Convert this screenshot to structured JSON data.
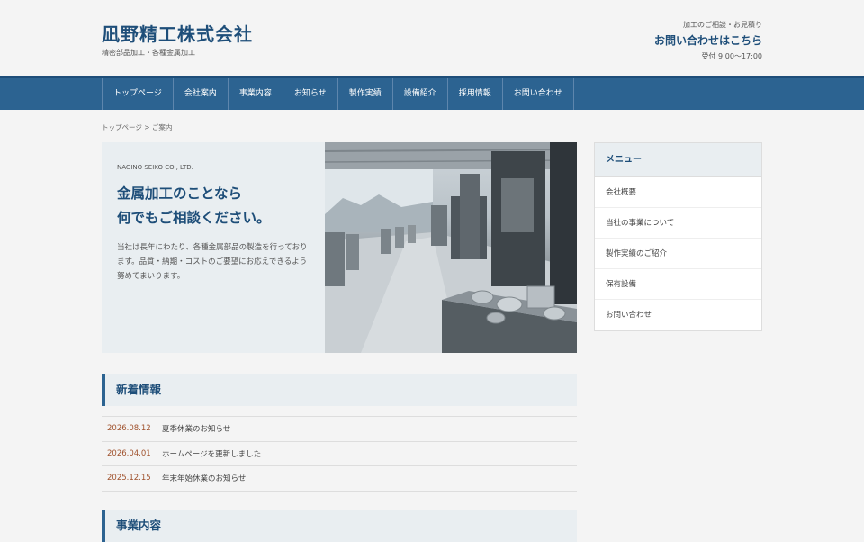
{
  "header": {
    "title": "凪野精工株式会社",
    "subtitle": "精密部品加工・各種金属加工",
    "contact_small": "加工のご相談・お見積り",
    "contact_main": "お問い合わせはこちら",
    "contact_hours": "受付 9:00〜17:00"
  },
  "nav": {
    "items": [
      "トップページ",
      "会社案内",
      "事業内容",
      "お知らせ",
      "製作実績",
      "設備紹介",
      "採用情報",
      "お問い合わせ"
    ]
  },
  "breadcrumb": {
    "home": "トップページ",
    "sep": " > ",
    "current": "ご案内"
  },
  "hero": {
    "company_en": "NAGINO SEIKO CO., LTD.",
    "title_line1": "金属加工のことなら",
    "title_line2": "何でもご相談ください。",
    "body": "当社は長年にわたり、各種金属部品の製造を行っております。品質・納期・コストのご要望にお応えできるよう努めてまいります。"
  },
  "news": {
    "heading": "新着情報",
    "items": [
      {
        "date": "2026.08.12",
        "title": "夏季休業のお知らせ"
      },
      {
        "date": "2026.04.01",
        "title": "ホームページを更新しました"
      },
      {
        "date": "2025.12.15",
        "title": "年末年始休業のお知らせ"
      }
    ]
  },
  "business": {
    "heading": "事業内容"
  },
  "sidebar": {
    "heading": "メニュー",
    "items": [
      "会社概要",
      "当社の事業について",
      "製作実績のご紹介",
      "保有設備",
      "お問い合わせ"
    ]
  },
  "colors": {
    "brand": "#1e4e79",
    "nav_bg": "#2c6391",
    "date": "#a0522d"
  }
}
